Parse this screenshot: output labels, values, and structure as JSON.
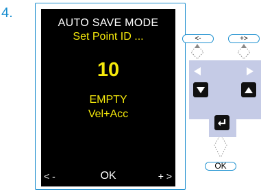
{
  "step": {
    "number": "4."
  },
  "screen": {
    "title": "AUTO SAVE MODE",
    "subtitle": "Set Point ID ...",
    "value": "10",
    "status": "EMPTY",
    "mode": "Vel+Acc",
    "softkeys": {
      "left": "< -",
      "center": "OK",
      "right": "+ >"
    }
  },
  "keypad": {
    "left_button": "<-",
    "right_button": "+>",
    "ok_button": "OK",
    "accent": "#1a8fd0",
    "pad_color": "#c5cbe6",
    "display_yellow": "#f4e80b"
  }
}
